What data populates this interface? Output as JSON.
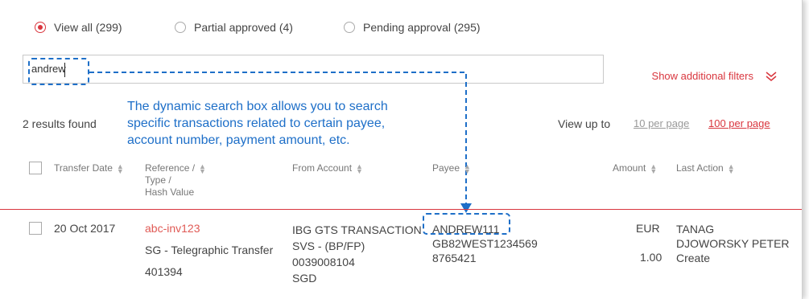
{
  "filters": {
    "view_all": "View all (299)",
    "partial": "Partial approved (4)",
    "pending": "Pending approval (295)",
    "selected": "View all (299)"
  },
  "search": {
    "value": "andrew",
    "placeholder": ""
  },
  "show_filters": "Show additional filters",
  "results_found": "2  results found",
  "view_up_to": "View up to",
  "per_page": [
    "10 per page",
    "100 per page"
  ],
  "annotation": [
    "The dynamic search box allows you to search",
    "specific transactions related to certain payee,",
    "account number, payment amount, etc."
  ],
  "columns": {
    "transfer_date": "Transfer Date",
    "reference": [
      "Reference /",
      "Type /",
      "Hash Value"
    ],
    "from_account": "From Account",
    "payee": "Payee",
    "amount": "Amount",
    "last_action": "Last Action"
  },
  "row": {
    "date": "20 Oct 2017",
    "reference": "abc-inv123",
    "type": "SG - Telegraphic Transfer",
    "hash": "401394",
    "from_account": [
      "IBG GTS TRANSACTION",
      "SVS - (BP/FP)",
      "0039008104",
      "SGD"
    ],
    "payee": [
      "ANDREW111",
      "GB82WEST1234569",
      "8765421"
    ],
    "currency": "EUR",
    "amount": "1.00",
    "last_action": [
      "TANAG",
      "DJOWORSKY PETER",
      "Create"
    ]
  },
  "colors": {
    "accent": "#d9363e",
    "annotation": "#1e6fc8"
  }
}
